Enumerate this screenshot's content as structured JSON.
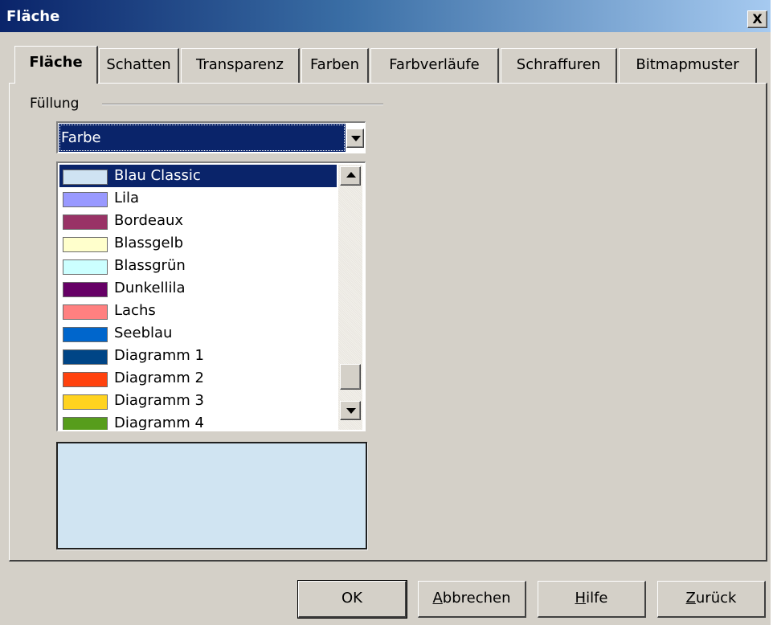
{
  "window": {
    "title": "Fläche",
    "close_label": "X"
  },
  "tabs": [
    {
      "label": "Fläche",
      "active": true
    },
    {
      "label": "Schatten"
    },
    {
      "label": "Transparenz"
    },
    {
      "label": "Farben"
    },
    {
      "label": "Farbverläufe"
    },
    {
      "label": "Schraffuren"
    },
    {
      "label": "Bitmapmuster"
    }
  ],
  "fill": {
    "group_label": "Füllung",
    "type_value": "Farbe",
    "colors": [
      {
        "name": "Blau Classic",
        "color": "#cfe3f2",
        "selected": true
      },
      {
        "name": "Lila",
        "color": "#9999ff"
      },
      {
        "name": "Bordeaux",
        "color": "#993366"
      },
      {
        "name": "Blassgelb",
        "color": "#ffffcc"
      },
      {
        "name": "Blassgrün",
        "color": "#ccffff"
      },
      {
        "name": "Dunkellila",
        "color": "#660066"
      },
      {
        "name": "Lachs",
        "color": "#ff8080"
      },
      {
        "name": "Seeblau",
        "color": "#0066cc"
      },
      {
        "name": "Diagramm 1",
        "color": "#004586"
      },
      {
        "name": "Diagramm 2",
        "color": "#ff420e"
      },
      {
        "name": "Diagramm 3",
        "color": "#ffd320"
      },
      {
        "name": "Diagramm 4",
        "color": "#579d1c"
      }
    ],
    "preview_color": "#d0e4f2"
  },
  "buttons": {
    "ok": "OK",
    "cancel_ul": "A",
    "cancel_rest": "bbrechen",
    "help_ul": "H",
    "help_rest": "ilfe",
    "back_ul": "Z",
    "back_rest": "urück"
  }
}
